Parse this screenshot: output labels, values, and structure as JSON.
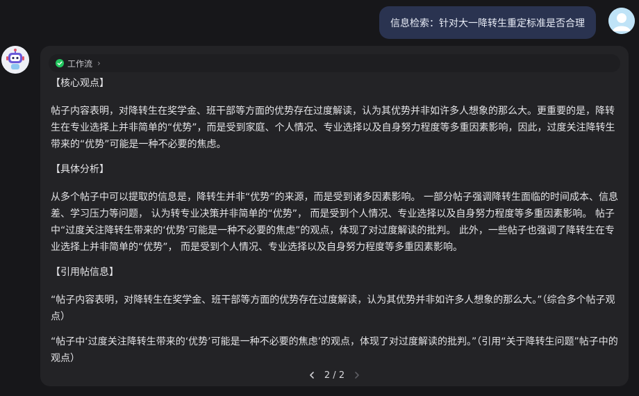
{
  "user_message": {
    "text": "信息检索：针对大一降转生重定标准是否合理"
  },
  "workflow": {
    "label": "工作流"
  },
  "response": {
    "core_heading": "【核心观点】",
    "core_text": "帖子内容表明，对降转生在奖学金、班干部等方面的优势存在过度解读，认为其优势并非如许多人想象的那么大。更重要的是，降转生在专业选择上并非简单的“优势”，而是受到家庭、个人情况、专业选择以及自身努力程度等多重因素影响，因此，过度关注降转生带来的“优势”可能是一种不必要的焦虑。",
    "analysis_heading": "【具体分析】",
    "analysis_text": "从多个帖子中可以提取的信息是，降转生并非“优势”的来源，而是受到诸多因素影响。 一部分帖子强调降转生面临的时间成本、信息差、学习压力等问题， 认为转专业决策并非简单的“优势”， 而是受到个人情况、专业选择以及自身努力程度等多重因素影响。 帖子中“过度关注降转生带来的‘优势’可能是一种不必要的焦虑”的观点，体现了对过度解读的批判。 此外，一些帖子也强调了降转生在专业选择上并非简单的“优势”， 而是受到个人情况、专业选择以及自身努力程度等多重因素影响。",
    "citation_heading": "【引用帖信息】",
    "citation_1": "“帖子内容表明，对降转生在奖学金、班干部等方面的优势存在过度解读，认为其优势并非如许多人想象的那么大。”（综合多个帖子观点）",
    "citation_2": "“帖子中‘过度关注降转生带来的‘优势’可能是一种不必要的焦虑’的观点，体现了对过度解读的批判。”（引用“关于降转生问题”帖子中的观点）"
  },
  "pager": {
    "label": "2 / 2"
  },
  "colors": {
    "background": "#17171a",
    "card": "#232326",
    "user_bubble": "#2a3350",
    "success": "#22c55e"
  }
}
